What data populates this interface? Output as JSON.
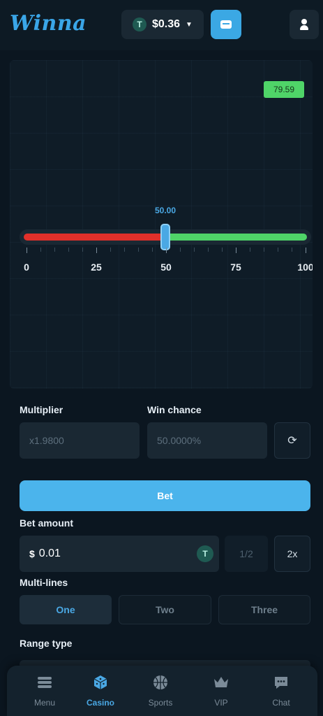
{
  "header": {
    "logo_text": "Winna",
    "balance": "$0.36",
    "currency_symbol": "T"
  },
  "game": {
    "result_value": "79.59",
    "slider_value": "50.00",
    "slider_position_percent": 50,
    "scale_labels": [
      "0",
      "25",
      "50",
      "75",
      "100"
    ]
  },
  "controls": {
    "multiplier_label": "Multiplier",
    "multiplier_value": "x1.9800",
    "win_chance_label": "Win chance",
    "win_chance_value": "50.0000%",
    "bet_button_label": "Bet",
    "bet_amount_label": "Bet amount",
    "bet_amount_prefix": "$",
    "bet_amount_value": "0.01",
    "half_label": "1/2",
    "double_label": "2x",
    "multilines_label": "Multi-lines",
    "multilines_options": [
      "One",
      "Two",
      "Three"
    ],
    "multilines_selected": "One",
    "range_type_label": "Range type"
  },
  "bottom_nav": {
    "items": [
      {
        "label": "Menu",
        "icon": "menu-icon"
      },
      {
        "label": "Casino",
        "icon": "dice-icon"
      },
      {
        "label": "Sports",
        "icon": "basketball-icon"
      },
      {
        "label": "VIP",
        "icon": "crown-icon"
      },
      {
        "label": "Chat",
        "icon": "chat-icon"
      }
    ],
    "active": "Casino"
  },
  "colors": {
    "accent": "#4aa8e4",
    "loss": "#e2302a",
    "win": "#4fd468",
    "background": "#0b1620"
  }
}
